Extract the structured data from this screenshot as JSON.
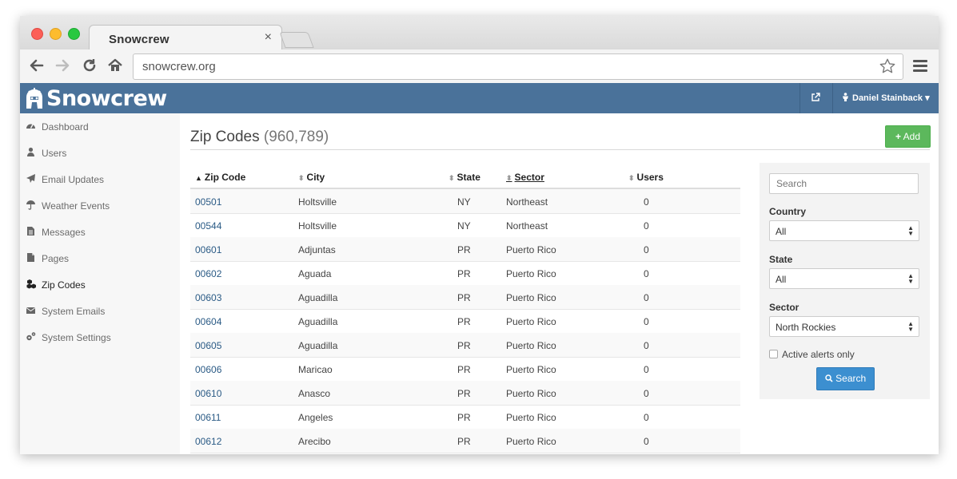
{
  "browser": {
    "tab_title": "Snowcrew",
    "tab_close": "×",
    "url": "snowcrew.org"
  },
  "header": {
    "logo_text": "Snowcrew",
    "user_menu": "Daniel Stainback ▾"
  },
  "sidebar": {
    "items": [
      {
        "label": "Dashboard",
        "icon": "dashboard-icon"
      },
      {
        "label": "Users",
        "icon": "user-icon"
      },
      {
        "label": "Email Updates",
        "icon": "paper-plane-icon"
      },
      {
        "label": "Weather Events",
        "icon": "umbrella-icon"
      },
      {
        "label": "Messages",
        "icon": "file-text-icon"
      },
      {
        "label": "Pages",
        "icon": "file-icon"
      },
      {
        "label": "Zip Codes",
        "icon": "cubes-icon"
      },
      {
        "label": "System Emails",
        "icon": "envelope-icon"
      },
      {
        "label": "System Settings",
        "icon": "cogs-icon"
      }
    ],
    "active_index": 6
  },
  "main": {
    "title": "Zip Codes",
    "count": "(960,789)",
    "add_label": "Add"
  },
  "table": {
    "columns": [
      "Zip Code",
      "City",
      "State",
      "Sector",
      "Users"
    ],
    "rows": [
      [
        "00501",
        "Holtsville",
        "NY",
        "Northeast",
        "0"
      ],
      [
        "00544",
        "Holtsville",
        "NY",
        "Northeast",
        "0"
      ],
      [
        "00601",
        "Adjuntas",
        "PR",
        "Puerto Rico",
        "0"
      ],
      [
        "00602",
        "Aguada",
        "PR",
        "Puerto Rico",
        "0"
      ],
      [
        "00603",
        "Aguadilla",
        "PR",
        "Puerto Rico",
        "0"
      ],
      [
        "00604",
        "Aguadilla",
        "PR",
        "Puerto Rico",
        "0"
      ],
      [
        "00605",
        "Aguadilla",
        "PR",
        "Puerto Rico",
        "0"
      ],
      [
        "00606",
        "Maricao",
        "PR",
        "Puerto Rico",
        "0"
      ],
      [
        "00610",
        "Anasco",
        "PR",
        "Puerto Rico",
        "0"
      ],
      [
        "00611",
        "Angeles",
        "PR",
        "Puerto Rico",
        "0"
      ],
      [
        "00612",
        "Arecibo",
        "PR",
        "Puerto Rico",
        "0"
      ]
    ]
  },
  "filters": {
    "search_placeholder": "Search",
    "country_label": "Country",
    "country_value": "All",
    "state_label": "State",
    "state_value": "All",
    "sector_label": "Sector",
    "sector_value": "North Rockies",
    "active_alerts_label": "Active alerts only",
    "search_button": "Search"
  },
  "colors": {
    "appbar": "#4a729a",
    "add_button": "#5cb85c",
    "search_button": "#3c8fd0",
    "link": "#2a5a85"
  }
}
